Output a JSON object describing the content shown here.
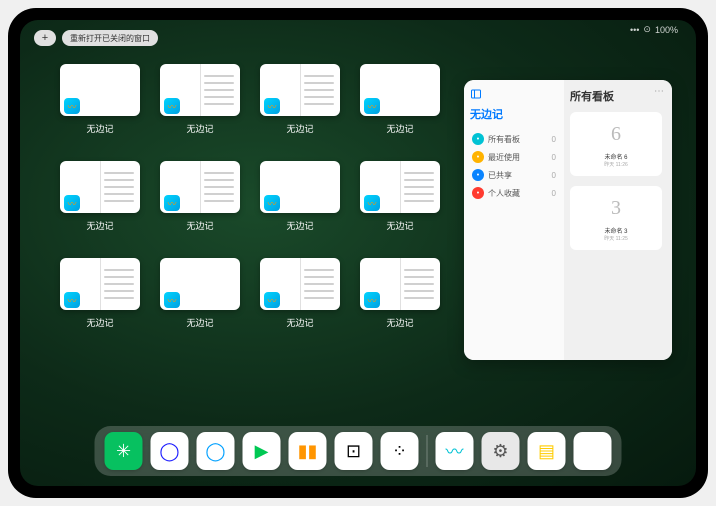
{
  "status": {
    "signal": "•••",
    "wifi": "⊙",
    "battery": "100%"
  },
  "topbar": {
    "plus": "+",
    "reopen": "重新打开已关闭的窗口"
  },
  "app_label": "无边记",
  "thumbs": [
    {
      "split": false
    },
    {
      "split": true
    },
    {
      "split": true
    },
    {
      "split": false
    },
    {
      "split": true
    },
    {
      "split": true
    },
    {
      "split": false
    },
    {
      "split": true
    },
    {
      "split": true
    },
    {
      "split": false
    },
    {
      "split": true
    },
    {
      "split": true
    }
  ],
  "panel": {
    "title": "无边记",
    "right_title": "所有看板",
    "items": [
      {
        "label": "所有看板",
        "count": "0",
        "color": "#00c2d4"
      },
      {
        "label": "最近使用",
        "count": "0",
        "color": "#ffb300"
      },
      {
        "label": "已共享",
        "count": "0",
        "color": "#0a84ff"
      },
      {
        "label": "个人收藏",
        "count": "0",
        "color": "#ff3b30"
      }
    ],
    "boards": [
      {
        "name": "未命名 6",
        "date": "昨天 11:26",
        "glyph": "6"
      },
      {
        "name": "未命名 3",
        "date": "昨天 11:25",
        "glyph": "3"
      }
    ]
  },
  "dock": [
    {
      "name": "wechat",
      "class": "wechat",
      "glyph": "✳"
    },
    {
      "name": "app-blue-circle",
      "class": "white",
      "glyph": "◯",
      "color": "#1a1aff"
    },
    {
      "name": "app-blue-q",
      "class": "white",
      "glyph": "◯",
      "color": "#00a0ff"
    },
    {
      "name": "app-play",
      "class": "white",
      "glyph": "▶",
      "color": "#00c853"
    },
    {
      "name": "books",
      "class": "white",
      "glyph": "▮▮",
      "color": "#ff9500"
    },
    {
      "name": "app-dice",
      "class": "white",
      "glyph": "⊡",
      "color": "#000"
    },
    {
      "name": "app-nodes",
      "class": "white",
      "glyph": "⁘",
      "color": "#000"
    },
    {
      "name": "freeform",
      "class": "white",
      "glyph": "〰",
      "color": "#00c2d4"
    },
    {
      "name": "settings",
      "class": "gray",
      "glyph": "⚙",
      "color": "#555"
    },
    {
      "name": "notes",
      "class": "white",
      "glyph": "▤",
      "color": "#ffcc00"
    }
  ]
}
